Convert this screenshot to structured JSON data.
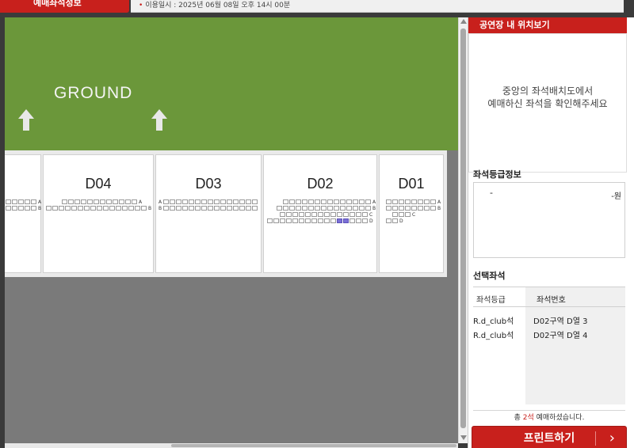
{
  "header": {
    "tab_label": "예매좌석정보",
    "date_text": "이용일시 : 2025년 06월 08일 오후 14시 00분"
  },
  "stage": {
    "ground_label": "GROUND",
    "blocks": [
      {
        "id": "d05",
        "title": ""
      },
      {
        "id": "d04",
        "title": "D04"
      },
      {
        "id": "d03",
        "title": "D03"
      },
      {
        "id": "d02",
        "title": "D02"
      },
      {
        "id": "d01",
        "title": "D01"
      }
    ],
    "row_labels": [
      "A",
      "B",
      "C",
      "D"
    ],
    "colors": {
      "ground": "#6b973a",
      "selected_seat": "#7a6fd6",
      "background": "#7a7a7a"
    }
  },
  "panel": {
    "location_title": "공연장 내 위치보기",
    "location_msg_line1": "중앙의 좌석배치도에서",
    "location_msg_line2": "예매하신 좌석을 확인해주세요",
    "grade_title": "좌석등급정보",
    "grade_name": "-",
    "grade_price": "-원",
    "selected_title": "선택좌석",
    "col_grade": "좌석등급",
    "col_seat": "좌석번호",
    "selected_seats": [
      {
        "grade": "R.d_club석",
        "seat": "D02구역 D열 3"
      },
      {
        "grade": "R.d_club석",
        "seat": "D02구역 D열 4"
      }
    ],
    "summary_prefix": "총",
    "summary_count": "2석",
    "summary_suffix": "예매하셨습니다.",
    "print_label": "프린트하기",
    "accent_color": "#c8201c"
  }
}
